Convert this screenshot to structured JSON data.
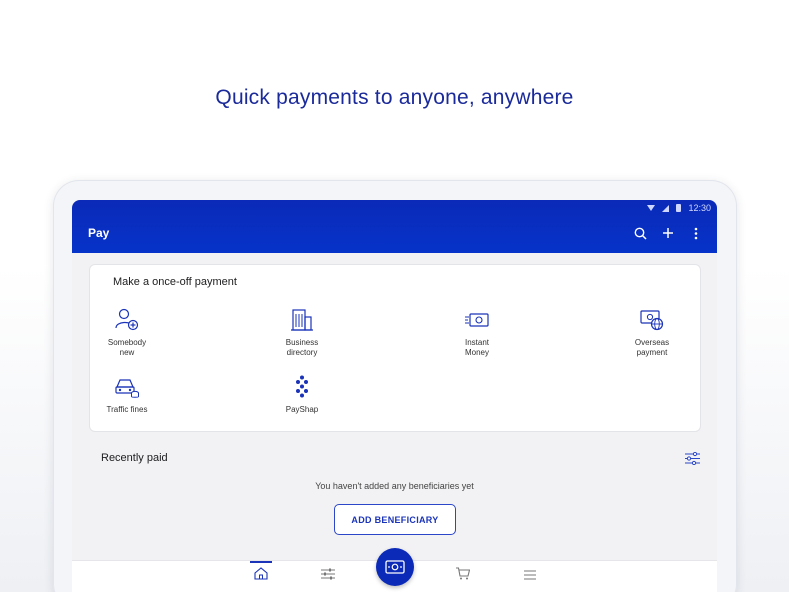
{
  "headline": "Quick payments to anyone, anywhere",
  "status_bar": {
    "time": "12:30"
  },
  "app_bar": {
    "title": "Pay",
    "icons": [
      "search-icon",
      "plus-icon",
      "more-vert-icon"
    ]
  },
  "once_off": {
    "title": "Make a once-off payment",
    "options": [
      {
        "line1": "Somebody",
        "line2": "new",
        "icon": "person-add-icon"
      },
      {
        "line1": "Business",
        "line2": "directory",
        "icon": "building-icon"
      },
      {
        "line1": "Instant",
        "line2": "Money",
        "icon": "cash-fast-icon"
      },
      {
        "line1": "Overseas",
        "line2": "payment",
        "icon": "globe-cash-icon"
      },
      {
        "line1": "Traffic fines",
        "line2": "",
        "icon": "car-coin-icon"
      },
      {
        "line1": "PayShap",
        "line2": "",
        "icon": "payshap-icon"
      }
    ]
  },
  "recent": {
    "title": "Recently paid",
    "empty_text": "You haven't added any beneficiaries yet",
    "add_button": "ADD BENEFICIARY"
  },
  "bottom_nav": {
    "icons": [
      "home-icon",
      "sliders-icon",
      "cash-icon",
      "cart-icon",
      "menu-icon"
    ]
  },
  "colors": {
    "primary": "#0b2ab8",
    "headline": "#1a2a9a",
    "accent_border": "#2b46c9"
  }
}
